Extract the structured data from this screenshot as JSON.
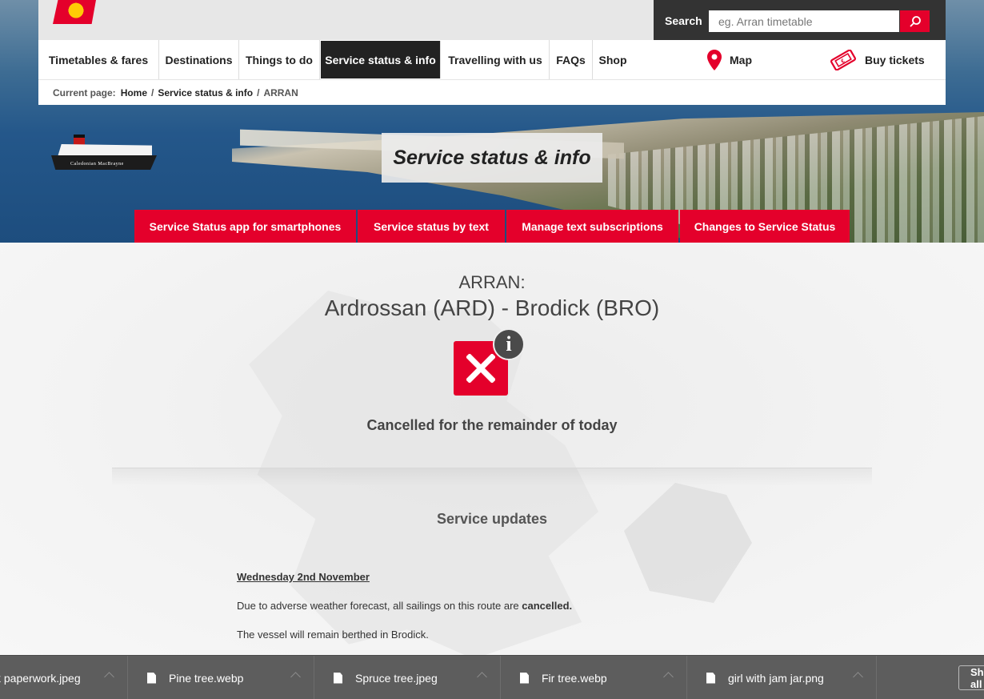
{
  "search": {
    "label": "Search",
    "placeholder": "eg. Arran timetable"
  },
  "nav": {
    "items": [
      "Timetables & fares",
      "Destinations",
      "Things to do",
      "Service status & info",
      "Travelling with us",
      "FAQs",
      "Shop"
    ],
    "active": "Service status & info",
    "map_label": "Map",
    "buy_label": "Buy tickets"
  },
  "breadcrumb": {
    "label": "Current page:",
    "items": [
      "Home",
      "Service status & info",
      "ARRAN"
    ]
  },
  "hero": {
    "title": "Service status & info",
    "ship_name": "Caledonian MacBrayne"
  },
  "action_buttons": [
    "Service Status app for smartphones",
    "Service status by text",
    "Manage text subscriptions",
    "Changes to Service Status"
  ],
  "route": {
    "island": "ARRAN:",
    "name": "Ardrossan (ARD) - Brodick (BRO)",
    "status": "Cancelled for the remainder of today"
  },
  "updates": {
    "title": "Service updates",
    "date": "Wednesday 2nd November",
    "line1_prefix": "Due to adverse weather forecast, all sailings on this route are ",
    "line1_bold": "cancelled.",
    "line2": "The vessel will remain berthed in Brodick."
  },
  "downloads": {
    "files": [
      "k paperwork.jpeg",
      "Pine tree.webp",
      "Spruce tree.jpeg",
      "Fir tree.webp",
      "girl with jam jar.png"
    ],
    "show_all": "Show all"
  },
  "colors": {
    "brand_red": "#e4002b",
    "nav_active": "#222222",
    "dl_bar": "#5d5d5d"
  }
}
